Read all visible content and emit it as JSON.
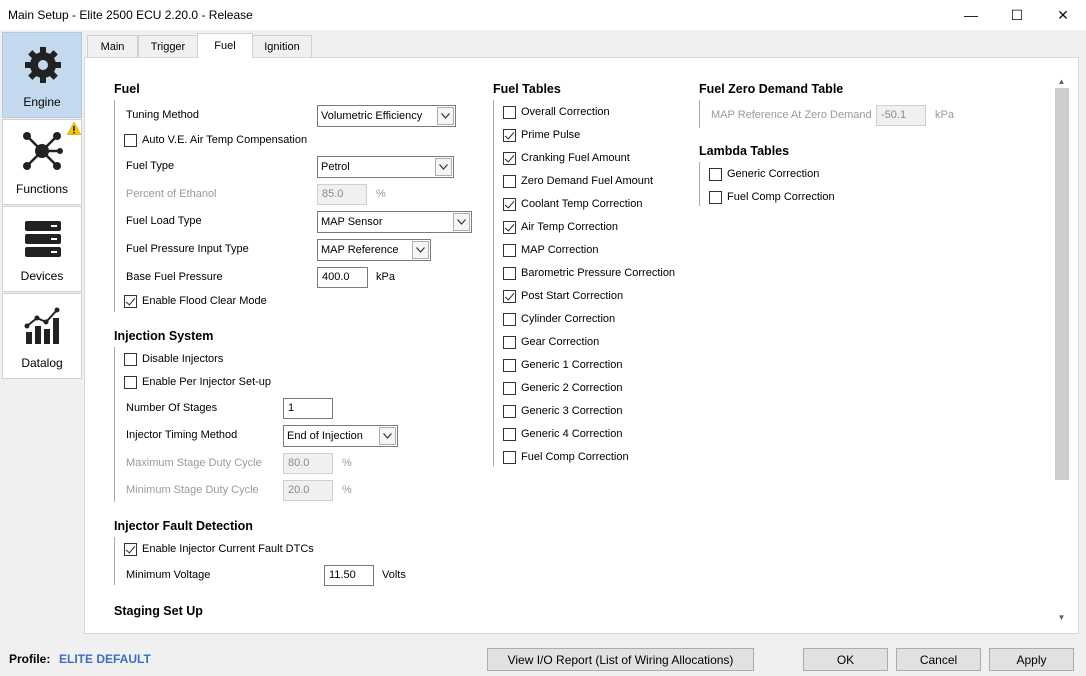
{
  "window": {
    "title": "Main Setup - Elite 2500 ECU 2.20.0 - Release",
    "minimize": "—",
    "maximize": "☐",
    "close": "✕"
  },
  "sidebar": {
    "items": [
      {
        "label": "Engine",
        "icon": "gear-icon",
        "active": true
      },
      {
        "label": "Functions",
        "icon": "network-icon",
        "warning": true
      },
      {
        "label": "Devices",
        "icon": "server-stack-icon"
      },
      {
        "label": "Datalog",
        "icon": "bar-chart-icon"
      }
    ]
  },
  "tabs": [
    "Main",
    "Trigger",
    "Fuel",
    "Ignition"
  ],
  "active_tab": "Fuel",
  "fuel": {
    "title": "Fuel",
    "tuning_method_label": "Tuning Method",
    "tuning_method_value": "Volumetric Efficiency",
    "auto_ve_label": "Auto V.E. Air Temp Compensation",
    "auto_ve_checked": false,
    "fuel_type_label": "Fuel Type",
    "fuel_type_value": "Petrol",
    "ethanol_label": "Percent of Ethanol",
    "ethanol_value": "85.0",
    "ethanol_unit": "%",
    "fuel_load_label": "Fuel Load Type",
    "fuel_load_value": "MAP Sensor",
    "pressure_input_label": "Fuel Pressure Input Type",
    "pressure_input_value": "MAP Reference",
    "base_pressure_label": "Base Fuel Pressure",
    "base_pressure_value": "400.0",
    "base_pressure_unit": "kPa",
    "flood_clear_label": "Enable Flood Clear Mode",
    "flood_clear_checked": true
  },
  "injection": {
    "title": "Injection System",
    "disable_injectors_label": "Disable Injectors",
    "per_injector_label": "Enable Per Injector Set-up",
    "stages_label": "Number Of Stages",
    "stages_value": "1",
    "timing_label": "Injector Timing Method",
    "timing_value": "End of Injection",
    "max_duty_label": "Maximum Stage Duty Cycle",
    "max_duty_value": "80.0",
    "min_duty_label": "Minimum Stage Duty Cycle",
    "min_duty_value": "20.0",
    "duty_unit": "%"
  },
  "fault": {
    "title": "Injector Fault Detection",
    "current_fault_label": "Enable Injector Current Fault DTCs",
    "current_fault_checked": true,
    "min_voltage_label": "Minimum Voltage",
    "min_voltage_value": "11.50",
    "min_voltage_unit": "Volts"
  },
  "staging": {
    "title": "Staging Set Up"
  },
  "fuel_tables": {
    "title": "Fuel Tables",
    "items": [
      {
        "label": "Overall Correction",
        "checked": false
      },
      {
        "label": "Prime Pulse",
        "checked": true
      },
      {
        "label": "Cranking Fuel Amount",
        "checked": true
      },
      {
        "label": "Zero Demand Fuel Amount",
        "checked": false
      },
      {
        "label": "Coolant Temp Correction",
        "checked": true
      },
      {
        "label": "Air Temp Correction",
        "checked": true
      },
      {
        "label": "MAP Correction",
        "checked": false
      },
      {
        "label": "Barometric Pressure Correction",
        "checked": false
      },
      {
        "label": "Post Start Correction",
        "checked": true
      },
      {
        "label": "Cylinder Correction",
        "checked": false
      },
      {
        "label": "Gear Correction",
        "checked": false
      },
      {
        "label": "Generic 1 Correction",
        "checked": false
      },
      {
        "label": "Generic 2 Correction",
        "checked": false
      },
      {
        "label": "Generic 3 Correction",
        "checked": false
      },
      {
        "label": "Generic 4 Correction",
        "checked": false
      },
      {
        "label": "Fuel Comp Correction",
        "checked": false
      }
    ]
  },
  "zero_demand": {
    "title": "Fuel Zero Demand Table",
    "map_ref_label": "MAP Reference At Zero Demand",
    "map_ref_value": "-50.1",
    "map_ref_unit": "kPa"
  },
  "lambda": {
    "title": "Lambda Tables",
    "items": [
      {
        "label": "Generic Correction",
        "checked": false
      },
      {
        "label": "Fuel Comp Correction",
        "checked": false
      }
    ]
  },
  "footer": {
    "profile_label": "Profile:",
    "profile_value": "ELITE DEFAULT",
    "io_report_button": "View I/O Report (List of Wiring Allocations)",
    "ok_button": "OK",
    "cancel_button": "Cancel",
    "apply_button": "Apply"
  },
  "colors": {
    "profile_value": "#3a6fc4",
    "sidebar_active": "#c5d9ee",
    "warning": "#f5c400"
  }
}
